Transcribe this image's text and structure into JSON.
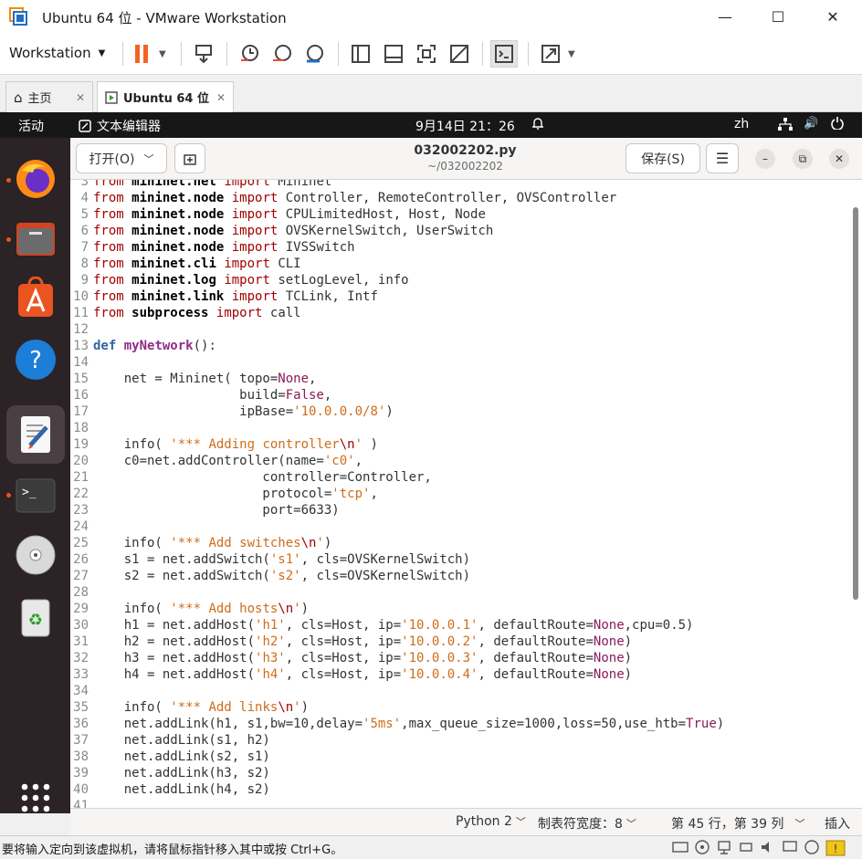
{
  "window": {
    "title": "Ubuntu 64 位 - VMware Workstation"
  },
  "toolbar": {
    "workstation_label": "Workstation"
  },
  "tabs": [
    {
      "label": "主页"
    },
    {
      "label": "Ubuntu 64 位"
    }
  ],
  "ubuntu_topbar": {
    "activities": "活动",
    "app_name": "文本编辑器",
    "clock": "9月14日  21：26",
    "input_method": "zh"
  },
  "gedit": {
    "open_label": "打开(O)",
    "file_title": "032002202.py",
    "file_path": "~/032002202",
    "save_label": "保存(S)"
  },
  "code_lines": [
    {
      "n": "3",
      "text": "from mininet.net import Mininet"
    },
    {
      "n": "4",
      "text": "from mininet.node import Controller, RemoteController, OVSController"
    },
    {
      "n": "5",
      "text": "from mininet.node import CPULimitedHost, Host, Node"
    },
    {
      "n": "6",
      "text": "from mininet.node import OVSKernelSwitch, UserSwitch"
    },
    {
      "n": "7",
      "text": "from mininet.node import IVSSwitch"
    },
    {
      "n": "8",
      "text": "from mininet.cli import CLI"
    },
    {
      "n": "9",
      "text": "from mininet.log import setLogLevel, info"
    },
    {
      "n": "10",
      "text": "from mininet.link import TCLink, Intf"
    },
    {
      "n": "11",
      "text": "from subprocess import call"
    },
    {
      "n": "12",
      "text": ""
    },
    {
      "n": "13",
      "text": "def myNetwork():"
    },
    {
      "n": "14",
      "text": ""
    },
    {
      "n": "15",
      "text": "    net = Mininet( topo=None,"
    },
    {
      "n": "16",
      "text": "                   build=False,"
    },
    {
      "n": "17",
      "text": "                   ipBase='10.0.0.0/8')"
    },
    {
      "n": "18",
      "text": ""
    },
    {
      "n": "19",
      "text": "    info( '*** Adding controller\\n' )"
    },
    {
      "n": "20",
      "text": "    c0=net.addController(name='c0',"
    },
    {
      "n": "21",
      "text": "                      controller=Controller,"
    },
    {
      "n": "22",
      "text": "                      protocol='tcp',"
    },
    {
      "n": "23",
      "text": "                      port=6633)"
    },
    {
      "n": "24",
      "text": ""
    },
    {
      "n": "25",
      "text": "    info( '*** Add switches\\n')"
    },
    {
      "n": "26",
      "text": "    s1 = net.addSwitch('s1', cls=OVSKernelSwitch)"
    },
    {
      "n": "27",
      "text": "    s2 = net.addSwitch('s2', cls=OVSKernelSwitch)"
    },
    {
      "n": "28",
      "text": ""
    },
    {
      "n": "29",
      "text": "    info( '*** Add hosts\\n')"
    },
    {
      "n": "30",
      "text": "    h1 = net.addHost('h1', cls=Host, ip='10.0.0.1', defaultRoute=None,cpu=0.5)"
    },
    {
      "n": "31",
      "text": "    h2 = net.addHost('h2', cls=Host, ip='10.0.0.2', defaultRoute=None)"
    },
    {
      "n": "32",
      "text": "    h3 = net.addHost('h3', cls=Host, ip='10.0.0.3', defaultRoute=None)"
    },
    {
      "n": "33",
      "text": "    h4 = net.addHost('h4', cls=Host, ip='10.0.0.4', defaultRoute=None)"
    },
    {
      "n": "34",
      "text": ""
    },
    {
      "n": "35",
      "text": "    info( '*** Add links\\n')"
    },
    {
      "n": "36",
      "text": "    net.addLink(h1, s1,bw=10,delay='5ms',max_queue_size=1000,loss=50,use_htb=True)"
    },
    {
      "n": "37",
      "text": "    net.addLink(s1, h2)"
    },
    {
      "n": "38",
      "text": "    net.addLink(s2, s1)"
    },
    {
      "n": "39",
      "text": "    net.addLink(h3, s2)"
    },
    {
      "n": "40",
      "text": "    net.addLink(h4, s2)"
    },
    {
      "n": "41",
      "text": ""
    }
  ],
  "status": {
    "language": "Python 2",
    "tab_width": "制表符宽度：8",
    "position": "第 45 行，第 39 列",
    "mode": "插入"
  },
  "vm_status": {
    "hint": "要将输入定向到该虚拟机，请将鼠标指针移入其中或按 Ctrl+G。"
  },
  "colors": {
    "accent": "#e95420",
    "topbar": "#171717",
    "dock": "#2b2326"
  }
}
